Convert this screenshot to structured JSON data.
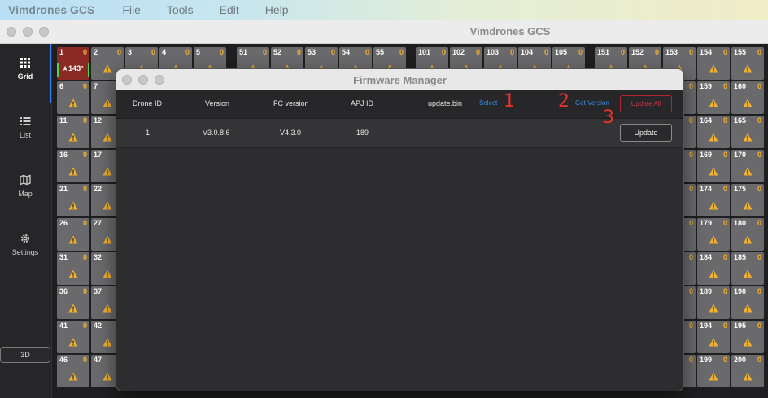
{
  "menubar": {
    "app": "Vimdrones GCS",
    "items": [
      "File",
      "Tools",
      "Edit",
      "Help"
    ]
  },
  "window": {
    "title": "Vimdrones GCS"
  },
  "sidebar": {
    "items": [
      {
        "label": "Grid",
        "icon": "grid-icon"
      },
      {
        "label": "List",
        "icon": "list-icon"
      },
      {
        "label": "Map",
        "icon": "map-icon"
      },
      {
        "label": "Settings",
        "icon": "gear-icon"
      }
    ],
    "btn3d": "3D"
  },
  "grid": {
    "selected_heading": "143°",
    "count": "0"
  },
  "dialog": {
    "title": "Firmware Manager",
    "headers": {
      "drone_id": "Drone ID",
      "version": "Version",
      "fc_version": "FC version",
      "apj_id": "APJ ID",
      "file": "update.bin",
      "select": "Select",
      "get_version": "Get Version",
      "update_all": "Update All"
    },
    "row": {
      "drone_id": "1",
      "version": "V3.0.8.6",
      "fc_version": "V4.3.0",
      "apj_id": "189",
      "update": "Update"
    },
    "annotations": [
      "1",
      "2",
      "3"
    ]
  },
  "colors": {
    "link": "#3a8ee6",
    "warn": "#f0b030",
    "danger": "#b3262f",
    "annotation": "#e0342c"
  }
}
